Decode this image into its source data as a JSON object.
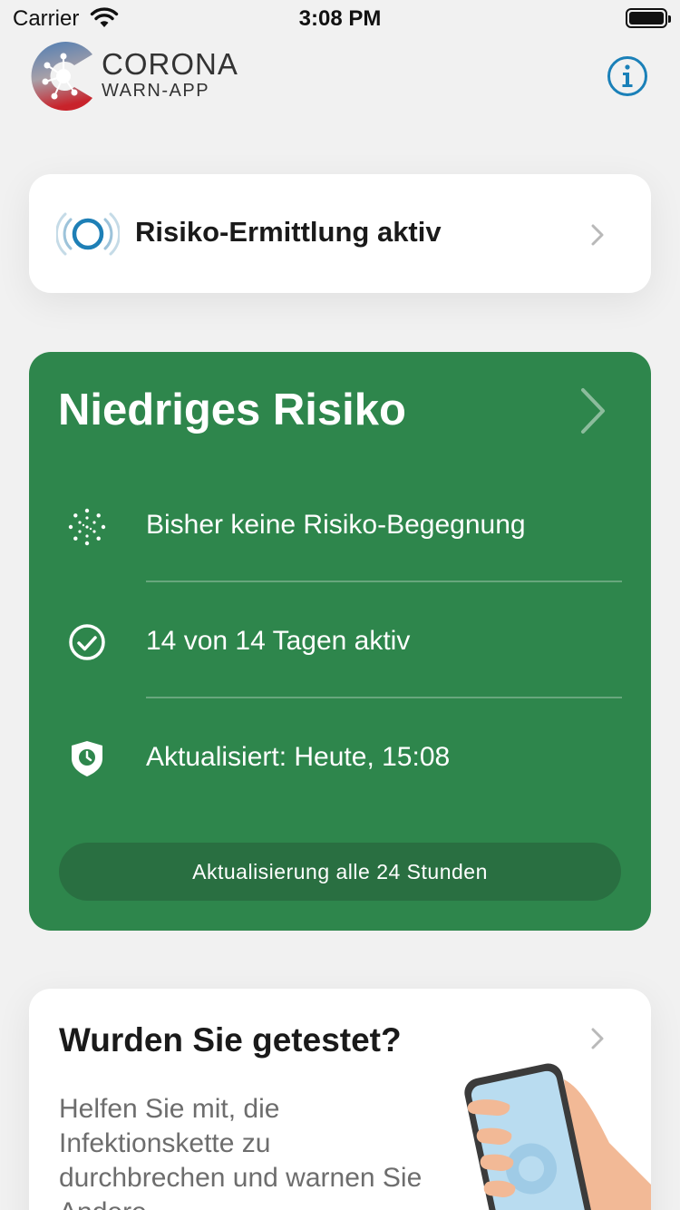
{
  "status_bar": {
    "carrier": "Carrier",
    "time": "3:08 PM"
  },
  "header": {
    "brand_title": "CORONA",
    "brand_subtitle": "WARN-APP",
    "info_icon": "info-icon"
  },
  "tracing": {
    "label": "Risiko-Ermittlung aktiv",
    "icon": "tracing-active-icon"
  },
  "risk": {
    "title": "Niedriges Risiko",
    "color": "#2e864c",
    "rows": [
      {
        "icon": "virus-icon",
        "text": "Bisher keine Risiko-Begegnung"
      },
      {
        "icon": "check-circle-icon",
        "text": "14 von 14 Tagen aktiv"
      },
      {
        "icon": "shield-clock-icon",
        "text": "Aktualisiert: Heute, 15:08"
      }
    ],
    "update_label": "Aktualisierung alle 24 Stunden"
  },
  "test": {
    "title": "Wurden Sie getestet?",
    "body": "Helfen Sie mit, die Infektionskette zu durchbrechen und warnen Sie Andere."
  }
}
